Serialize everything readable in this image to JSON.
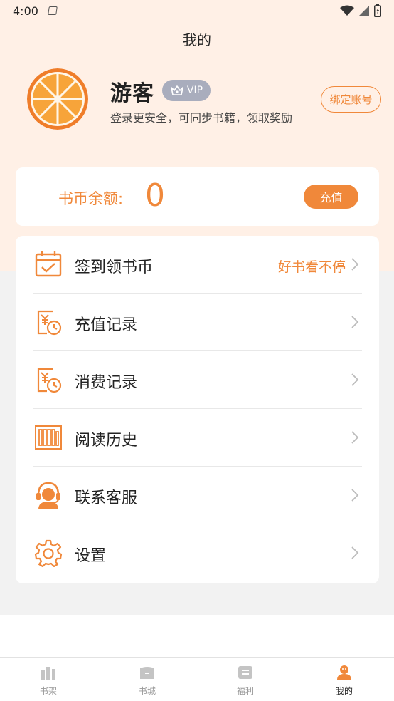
{
  "status_bar": {
    "time": "4:00"
  },
  "header": {
    "title": "我的"
  },
  "profile": {
    "name": "游客",
    "vip_label": "VIP",
    "description": "登录更安全，可同步书籍，领取奖励",
    "bind_label": "绑定账号"
  },
  "balance": {
    "label": "书币余额:",
    "value": "0",
    "recharge_label": "充值"
  },
  "menu": {
    "items": [
      {
        "label": "签到领书币",
        "extra": "好书看不停",
        "icon": "calendar-check-icon"
      },
      {
        "label": "充值记录",
        "extra": "",
        "icon": "yuan-clock-icon"
      },
      {
        "label": "消费记录",
        "extra": "",
        "icon": "yuan-clock-icon"
      },
      {
        "label": "阅读历史",
        "extra": "",
        "icon": "books-icon"
      },
      {
        "label": "联系客服",
        "extra": "",
        "icon": "customer-service-icon"
      },
      {
        "label": "设置",
        "extra": "",
        "icon": "gear-icon"
      }
    ]
  },
  "tabs": [
    {
      "label": "书架",
      "icon": "bookshelf-icon",
      "active": false
    },
    {
      "label": "书城",
      "icon": "bookstore-icon",
      "active": false
    },
    {
      "label": "福利",
      "icon": "welfare-icon",
      "active": false
    },
    {
      "label": "我的",
      "icon": "user-icon",
      "active": true
    }
  ],
  "colors": {
    "accent": "#f0883a",
    "header_bg": "#fff0e6",
    "page_bg": "#f2f2f2",
    "vip_badge": "#a9adbd"
  }
}
